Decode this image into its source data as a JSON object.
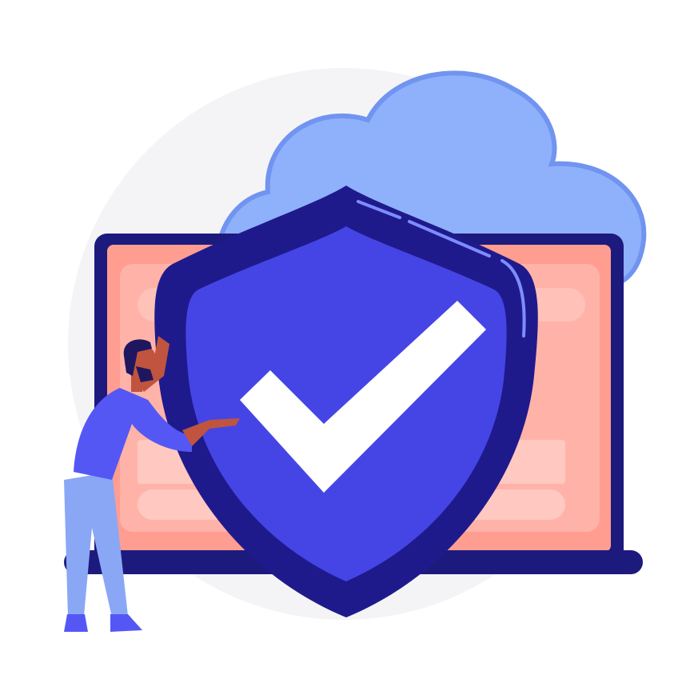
{
  "illustration": {
    "icons": [
      "background-circle",
      "cloud-icon",
      "laptop-icon",
      "shield-icon",
      "checkmark-icon",
      "person-figure"
    ],
    "colors": {
      "background_circle": "#f4f4f6",
      "cloud_fill": "#8fb0fb",
      "cloud_outline": "#7094f0",
      "laptop_frame": "#1d1a7e",
      "laptop_screen": "#ff9d90",
      "laptop_screen_light": "#ffc1b8",
      "shield_outer": "#1f1a8c",
      "shield_inner": "#4545e6",
      "shield_highlight": "#7d8cff",
      "checkmark": "#ffffff",
      "person_shirt": "#5557f5",
      "person_pants": "#8aa7f5",
      "person_skin": "#c0543e",
      "person_hair": "#1e1760"
    }
  }
}
